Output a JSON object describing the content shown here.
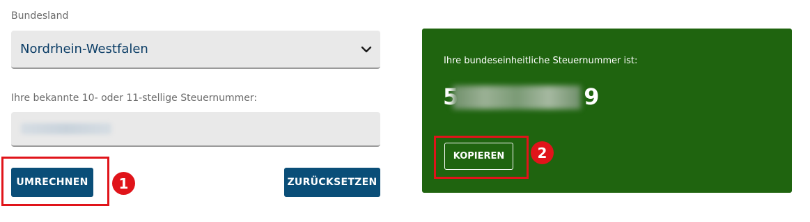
{
  "form": {
    "state_label": "Bundesland",
    "state_value": "Nordrhein-Westfalen",
    "taxnum_label": "Ihre bekannte 10- oder 11-stellige Steuernummer:",
    "taxnum_value": ""
  },
  "buttons": {
    "convert": "UMRECHNEN",
    "reset": "ZURÜCKSETZEN",
    "copy": "KOPIEREN"
  },
  "result": {
    "title": "Ihre bundeseinheitliche Steuernummer ist:",
    "number_first_digit": "5",
    "number_last_digit": "9"
  },
  "annotations": {
    "badge_1": "1",
    "badge_2": "2"
  },
  "colors": {
    "primary_button": "#0a4e78",
    "result_panel": "#1f640f",
    "highlight": "#e0141a"
  }
}
